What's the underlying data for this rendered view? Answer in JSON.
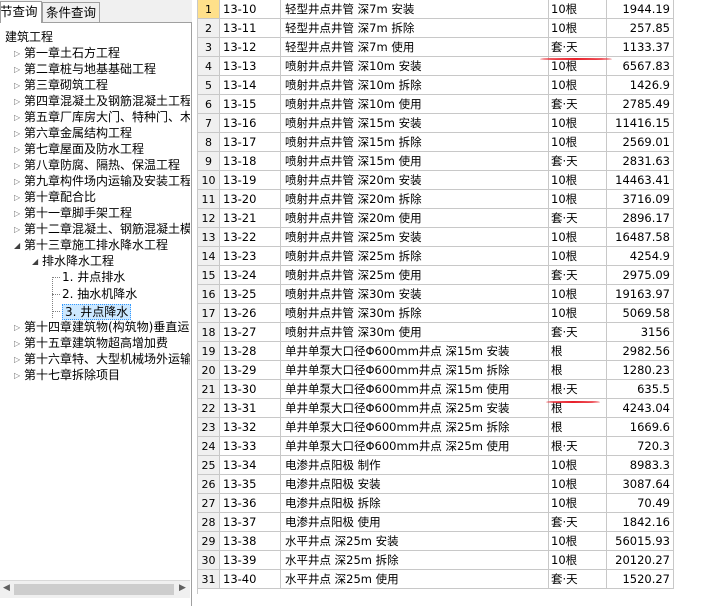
{
  "tabs": [
    "节查询",
    "条件查询"
  ],
  "tree": {
    "root": "建筑工程",
    "chapters": [
      "第一章土石方工程",
      "第二章桩与地基基础工程",
      "第三章砌筑工程",
      "第四章混凝土及钢筋混凝土工程",
      "第五章厂库房大门、特种门、木结构工程",
      "第六章金属结构工程",
      "第七章屋面及防水工程",
      "第八章防腐、隔热、保温工程",
      "第九章构件场内运输及安装工程",
      "第十章配合比",
      "第十一章脚手架工程",
      "第十二章混凝土、钢筋混凝土模板及支撑工程",
      "第十三章施工排水降水工程"
    ],
    "sub": "排水降水工程",
    "leaves": [
      "1. 井点排水",
      "2. 抽水机降水",
      "3. 井点降水"
    ],
    "after": [
      "第十四章建筑物(构筑物)垂直运输",
      "第十五章建筑物超高增加费",
      "第十六章特、大型机械场外运输",
      "第十七章拆除项目"
    ]
  },
  "rows": [
    [
      "1",
      "13-10",
      "轻型井点井管 深7m 安装",
      "10根",
      "1944.19"
    ],
    [
      "2",
      "13-11",
      "轻型井点井管 深7m 拆除",
      "10根",
      "257.85"
    ],
    [
      "3",
      "13-12",
      "轻型井点井管 深7m 使用",
      "套·天",
      "1133.37"
    ],
    [
      "4",
      "13-13",
      "喷射井点井管 深10m 安装",
      "10根",
      "6567.83"
    ],
    [
      "5",
      "13-14",
      "喷射井点井管 深10m 拆除",
      "10根",
      "1426.9"
    ],
    [
      "6",
      "13-15",
      "喷射井点井管 深10m 使用",
      "套·天",
      "2785.49"
    ],
    [
      "7",
      "13-16",
      "喷射井点井管 深15m 安装",
      "10根",
      "11416.15"
    ],
    [
      "8",
      "13-17",
      "喷射井点井管 深15m 拆除",
      "10根",
      "2569.01"
    ],
    [
      "9",
      "13-18",
      "喷射井点井管 深15m 使用",
      "套·天",
      "2831.63"
    ],
    [
      "10",
      "13-19",
      "喷射井点井管 深20m 安装",
      "10根",
      "14463.41"
    ],
    [
      "11",
      "13-20",
      "喷射井点井管 深20m 拆除",
      "10根",
      "3716.09"
    ],
    [
      "12",
      "13-21",
      "喷射井点井管 深20m 使用",
      "套·天",
      "2896.17"
    ],
    [
      "13",
      "13-22",
      "喷射井点井管 深25m 安装",
      "10根",
      "16487.58"
    ],
    [
      "14",
      "13-23",
      "喷射井点井管 深25m 拆除",
      "10根",
      "4254.9"
    ],
    [
      "15",
      "13-24",
      "喷射井点井管 深25m 使用",
      "套·天",
      "2975.09"
    ],
    [
      "16",
      "13-25",
      "喷射井点井管 深30m 安装",
      "10根",
      "19163.97"
    ],
    [
      "17",
      "13-26",
      "喷射井点井管 深30m 拆除",
      "10根",
      "5069.58"
    ],
    [
      "18",
      "13-27",
      "喷射井点井管 深30m 使用",
      "套·天",
      "3156"
    ],
    [
      "19",
      "13-28",
      "单井单泵大口径Φ600mm井点 深15m 安装",
      "根",
      "2982.56"
    ],
    [
      "20",
      "13-29",
      "单井单泵大口径Φ600mm井点 深15m 拆除",
      "根",
      "1280.23"
    ],
    [
      "21",
      "13-30",
      "单井单泵大口径Φ600mm井点 深15m 使用",
      "根·天",
      "635.5"
    ],
    [
      "22",
      "13-31",
      "单井单泵大口径Φ600mm井点 深25m 安装",
      "根",
      "4243.04"
    ],
    [
      "23",
      "13-32",
      "单井单泵大口径Φ600mm井点 深25m 拆除",
      "根",
      "1669.6"
    ],
    [
      "24",
      "13-33",
      "单井单泵大口径Φ600mm井点 深25m 使用",
      "根·天",
      "720.3"
    ],
    [
      "25",
      "13-34",
      "电渗井点阳极 制作",
      "10根",
      "8983.3"
    ],
    [
      "26",
      "13-35",
      "电渗井点阳极 安装",
      "10根",
      "3087.64"
    ],
    [
      "27",
      "13-36",
      "电渗井点阳极 拆除",
      "10根",
      "70.49"
    ],
    [
      "28",
      "13-37",
      "电渗井点阳极 使用",
      "套·天",
      "1842.16"
    ],
    [
      "29",
      "13-38",
      "水平井点 深25m 安装",
      "10根",
      "56015.93"
    ],
    [
      "30",
      "13-39",
      "水平井点 深25m 拆除",
      "10根",
      "20120.27"
    ],
    [
      "31",
      "13-40",
      "水平井点 深25m 使用",
      "套·天",
      "1520.27"
    ]
  ],
  "colors": {
    "selection": "#cce8ff",
    "annotation": "#e8212b",
    "header": "#f0f0f0"
  },
  "icons": [
    "collapsed-arrow-icon",
    "expanded-arrow-icon",
    "scroll-left-icon",
    "scroll-right-icon"
  ]
}
